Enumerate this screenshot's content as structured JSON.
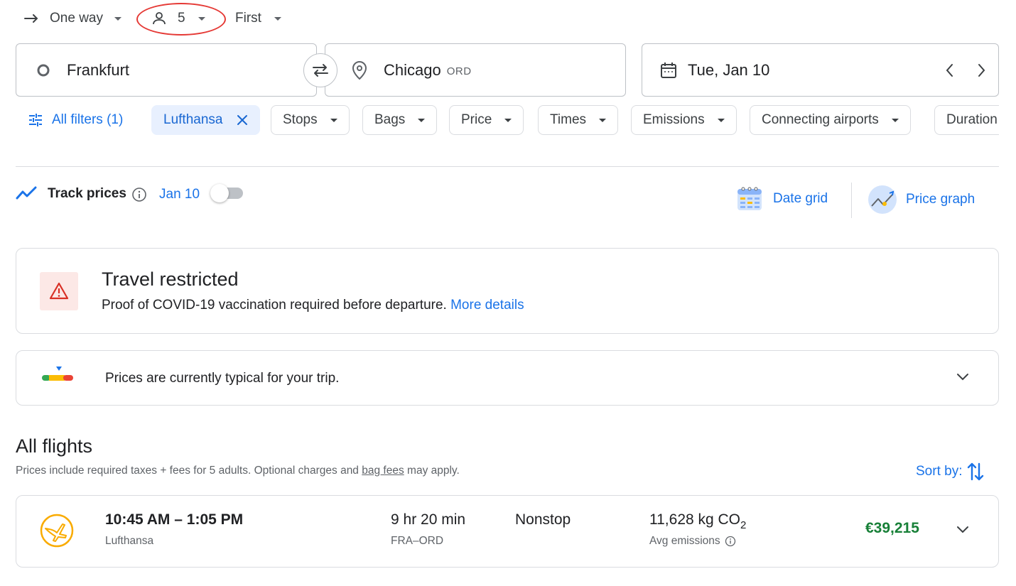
{
  "trip": {
    "type_label": "One way",
    "passengers": "5",
    "cabin": "First"
  },
  "search": {
    "origin": "Frankfurt",
    "destination": "Chicago",
    "destination_code": "ORD",
    "date": "Tue, Jan 10"
  },
  "filters": {
    "all_filters": "All filters (1)",
    "airline": "Lufthansa",
    "chips": [
      "Stops",
      "Bags",
      "Price",
      "Times",
      "Emissions",
      "Connecting airports",
      "Duration"
    ]
  },
  "track": {
    "label": "Track prices",
    "date": "Jan 10",
    "enabled": false
  },
  "tools": {
    "date_grid": "Date grid",
    "price_graph": "Price graph"
  },
  "restriction": {
    "title": "Travel restricted",
    "body": "Proof of COVID-19 vaccination required before departure.",
    "link": "More details"
  },
  "price_insight": {
    "text": "Prices are currently typical for your trip."
  },
  "results": {
    "heading": "All flights",
    "note_prefix": "Prices include required taxes + fees for 5 adults. Optional charges and",
    "note_link": "bag fees",
    "note_suffix": "may apply.",
    "sort_label": "Sort by:"
  },
  "flights": [
    {
      "times": "10:45 AM – 1:05 PM",
      "airline": "Lufthansa",
      "duration": "9 hr 20 min",
      "route": "FRA–ORD",
      "stops": "Nonstop",
      "emissions": "11,628 kg CO",
      "emissions_sub": "2",
      "emissions_label": "Avg emissions",
      "price": "€39,215"
    }
  ],
  "colors": {
    "accent": "#1a73e8",
    "price_green": "#188038",
    "warning_red": "#d93025",
    "warning_bg": "#fce8e6",
    "lufthansa_yellow": "#f9ab00"
  }
}
